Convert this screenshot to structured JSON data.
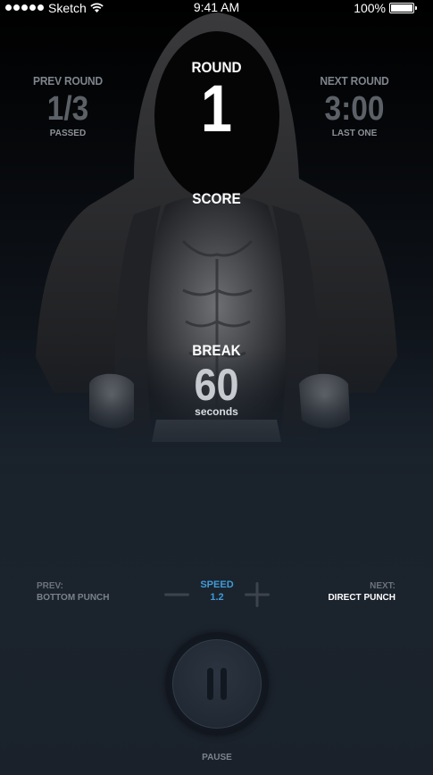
{
  "status_bar": {
    "carrier": "Sketch",
    "time": "9:41 AM",
    "battery": "100%",
    "battery_level": 1.0,
    "signal_icon": "signal-dots-icon",
    "wifi_icon": "wifi-icon",
    "battery_icon": "battery-icon"
  },
  "round_info": {
    "prev": {
      "label": "PREV ROUND",
      "value": "1/3",
      "sub": "PASSED"
    },
    "current": {
      "label": "ROUND",
      "value": "1"
    },
    "next": {
      "label": "NEXT ROUND",
      "value": "3:00",
      "sub": "LAST ONE"
    }
  },
  "score": {
    "label": "SCORE"
  },
  "break": {
    "label": "BREAK",
    "value": "60",
    "unit": "seconds"
  },
  "controls": {
    "prev_label": "PREV:",
    "prev_punch": "BOTTOM PUNCH",
    "next_label": "NEXT:",
    "next_punch": "DIRECT PUNCH",
    "speed_label": "SPEED",
    "speed_value": "1.2",
    "minus_icon": "minus-icon",
    "plus_icon": "plus-icon"
  },
  "pause": {
    "label": "PAUSE",
    "icon": "pause-icon"
  },
  "colors": {
    "accent": "#3f9bd8",
    "background": "#1b232d",
    "muted_text": "#7f858d"
  }
}
